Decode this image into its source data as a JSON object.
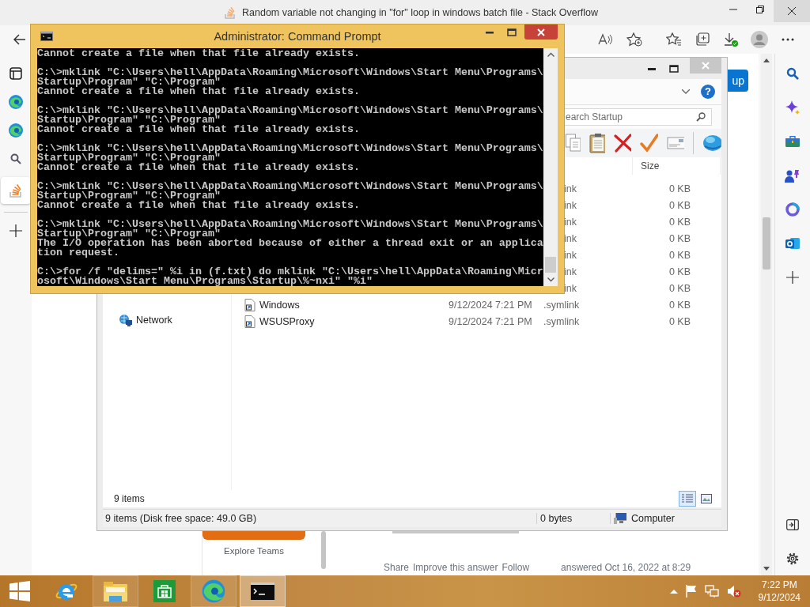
{
  "browser": {
    "title": "Random variable not changing in \"for\" loop in windows batch file - Stack Overflow",
    "vertical_tabs": [
      {
        "kind": "edge",
        "selected": false
      },
      {
        "kind": "edge",
        "selected": false
      },
      {
        "kind": "search",
        "selected": false
      },
      {
        "kind": "stackoverflow",
        "selected": true
      }
    ],
    "page": {
      "button_fragment": "up",
      "sidebar_link": "Explore Teams",
      "post_actions": [
        "Share",
        "Improve this answer",
        "Follow"
      ],
      "answered": "answered Oct 16, 2022 at 8:29"
    }
  },
  "explorer": {
    "help_button": "?",
    "search_placeholder": "earch Startup",
    "size_header": "Size",
    "rows": [
      {
        "type": "ink",
        "size": "0 KB"
      },
      {
        "type": "ink",
        "size": "0 KB"
      },
      {
        "type": "ink",
        "size": "0 KB"
      },
      {
        "type": "ink",
        "size": "0 KB"
      },
      {
        "type": "ink",
        "size": "0 KB"
      },
      {
        "type": "ink",
        "size": "0 KB"
      },
      {
        "type": "ink",
        "size": "0 KB"
      },
      {
        "name": "Windows",
        "date": "9/12/2024 7:21 PM",
        "type": ".symlink",
        "size": "0 KB"
      },
      {
        "name": "WSUSProxy",
        "date": "9/12/2024 7:21 PM",
        "type": ".symlink",
        "size": "0 KB"
      }
    ],
    "nav_items": [
      "Network"
    ],
    "item_count": "9 items",
    "view_modes": [
      {
        "kind": "details",
        "selected": true
      },
      {
        "kind": "tiles",
        "selected": false
      }
    ],
    "status": {
      "summary": "9 items (Disk free space: 49.0 GB)",
      "selection_size": "0 bytes",
      "zone": "Computer"
    }
  },
  "cmd": {
    "title": "Administrator: Command Prompt",
    "blocks": [
      [
        "Cannot create a file when that file already exists."
      ],
      [
        "C:\\>mklink \"C:\\Users\\hell\\AppData\\Roaming\\Microsoft\\Windows\\Start Menu\\Programs\\",
        "Startup\\Program\" \"C:\\Program\"",
        "Cannot create a file when that file already exists."
      ],
      [
        "C:\\>mklink \"C:\\Users\\hell\\AppData\\Roaming\\Microsoft\\Windows\\Start Menu\\Programs\\",
        "Startup\\Program\" \"C:\\Program\"",
        "Cannot create a file when that file already exists."
      ],
      [
        "C:\\>mklink \"C:\\Users\\hell\\AppData\\Roaming\\Microsoft\\Windows\\Start Menu\\Programs\\",
        "Startup\\Program\" \"C:\\Program\"",
        "Cannot create a file when that file already exists."
      ],
      [
        "C:\\>mklink \"C:\\Users\\hell\\AppData\\Roaming\\Microsoft\\Windows\\Start Menu\\Programs\\",
        "Startup\\Program\" \"C:\\Program\"",
        "Cannot create a file when that file already exists."
      ],
      [
        "C:\\>mklink \"C:\\Users\\hell\\AppData\\Roaming\\Microsoft\\Windows\\Start Menu\\Programs\\",
        "Startup\\Program\" \"C:\\Program\"",
        "The I/O operation has been aborted because of either a thread exit or an applica",
        "tion request."
      ],
      [
        "C:\\>for /f \"delims=\" %i in (f.txt) do mklink \"C:\\Users\\hell\\AppData\\Roaming\\Micr",
        "osoft\\Windows\\Start Menu\\Programs\\Startup\\%~nxi\" \"%i\""
      ]
    ]
  },
  "taskbar": {
    "apps": [
      {
        "kind": "ie",
        "running": false,
        "selected": false
      },
      {
        "kind": "explorer",
        "running": true,
        "selected": false
      },
      {
        "kind": "store",
        "running": false,
        "selected": false
      },
      {
        "kind": "edge",
        "running": true,
        "selected": false
      },
      {
        "kind": "cmd",
        "running": true,
        "selected": true
      }
    ],
    "clock": {
      "time": "7:22 PM",
      "date": "9/12/2024"
    }
  }
}
